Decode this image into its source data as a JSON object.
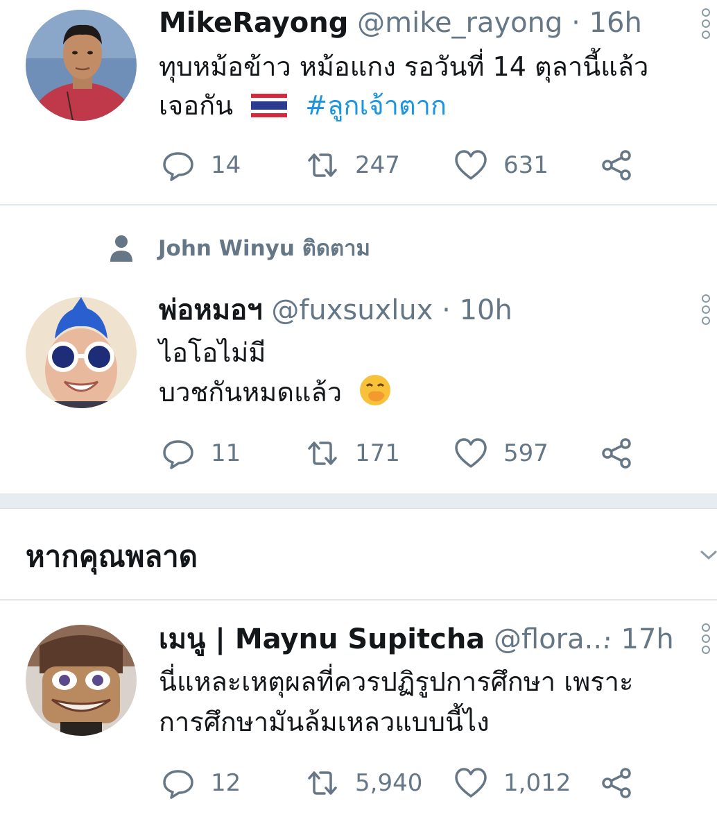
{
  "colors": {
    "text": "#14171a",
    "secondary": "#657786",
    "link": "#1b95e0",
    "divider": "#e6ecf0"
  },
  "tweets": [
    {
      "name": "MikeRayong",
      "handle": "@mike_rayong",
      "separator": "·",
      "time": "16h",
      "lines": [
        "ทุบหม้อข้าว หม้อแกง รอวันที่ 14 ตุลานี้แล้ว",
        "เจอกัน"
      ],
      "flag": "thailand-flag-emoji",
      "hashtag": "#ลูกเจ้าตาก",
      "counts": {
        "replies": "14",
        "retweets": "247",
        "likes": "631"
      }
    },
    {
      "social_context": "John Winyu ติดตาม",
      "name": "พ่อหมอฯ",
      "handle": "@fuxsuxlux",
      "separator": "·",
      "time": "10h",
      "lines": [
        "ไอโอไม่มี",
        "บวชกันหมดแล้ว"
      ],
      "emoji": "hand-over-mouth-emoji",
      "counts": {
        "replies": "11",
        "retweets": "171",
        "likes": "597"
      }
    },
    {
      "name": "เมนู | Maynu Supitcha",
      "handle": "@flora...",
      "separator": "·",
      "time": "17h",
      "lines": [
        "นี่แหละเหตุผลที่ควรปฏิรูปการศึกษา เพราะ",
        "การศึกษามันล้มเหลวแบบนี้ไง"
      ],
      "counts": {
        "replies": "12",
        "retweets": "5,940",
        "likes": "1,012"
      }
    }
  ],
  "section": {
    "title": "หากคุณพลาด"
  },
  "icons": {
    "reply": "reply-icon",
    "retweet": "retweet-icon",
    "like": "heart-icon",
    "share": "share-icon",
    "more": "more-vertical-icon",
    "person": "person-icon",
    "chevron": "chevron-down-icon"
  }
}
